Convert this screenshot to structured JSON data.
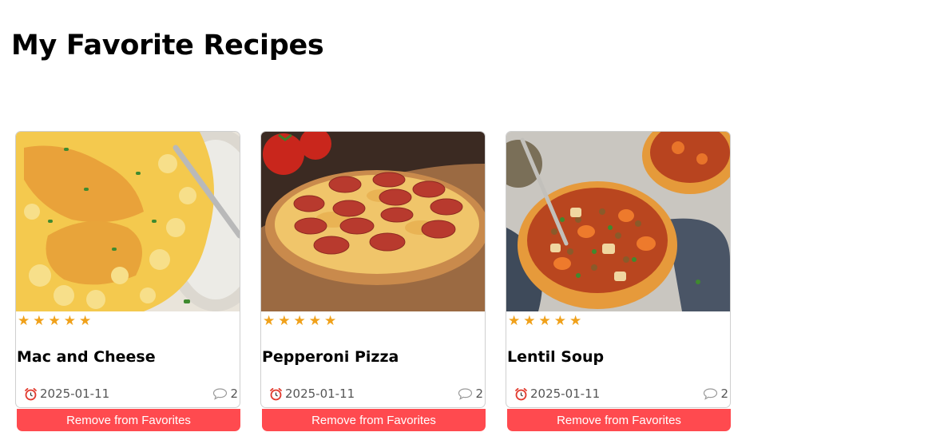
{
  "page": {
    "title": "My Favorite Recipes"
  },
  "recipes": [
    {
      "title": "Mac and Cheese",
      "rating": 5,
      "date": "2025-01-11",
      "comments": "2",
      "image_subject": "mac-and-cheese-photo",
      "remove_label": "Remove from Favorites"
    },
    {
      "title": "Pepperoni Pizza",
      "rating": 5,
      "date": "2025-01-11",
      "comments": "2",
      "image_subject": "pepperoni-pizza-photo",
      "remove_label": "Remove from Favorites"
    },
    {
      "title": "Lentil Soup",
      "rating": 5,
      "date": "2025-01-11",
      "comments": "2",
      "image_subject": "lentil-soup-photo",
      "remove_label": "Remove from Favorites"
    }
  ],
  "icons": {
    "star": "star-icon",
    "date": "alarm-clock-icon",
    "comments": "comment-icon"
  },
  "colors": {
    "accent_button": "#ff4a4f",
    "star": "#f0a11a",
    "alarm_icon": "#e23a2e",
    "muted_text": "#555555"
  }
}
